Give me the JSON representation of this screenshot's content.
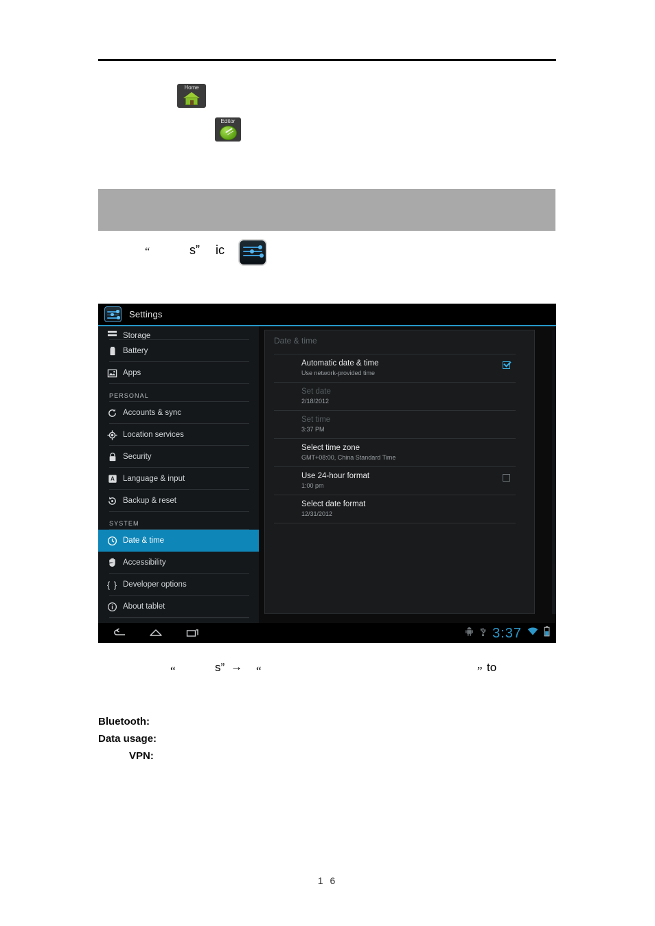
{
  "document": {
    "page_number": "1 6",
    "app_icons": [
      {
        "name": "home-app-icon",
        "caption": "Home"
      },
      {
        "name": "editor-app-icon",
        "caption": "Editor"
      }
    ],
    "inline_line": {
      "quote_open": "“",
      "fragment_s": "s”",
      "trailing": "ic"
    },
    "instruction_line": {
      "quote_open_1": "“",
      "fragment_s": "s”",
      "arrow": "→",
      "quote_open_2": "“",
      "quote_close": "”",
      "trailing": "to"
    },
    "terms": [
      {
        "label": "Bluetooth:",
        "indent": false
      },
      {
        "label": "Data usage:",
        "indent": false
      },
      {
        "label": "VPN:",
        "indent": true
      }
    ]
  },
  "tablet": {
    "title": "Settings",
    "accent_color": "#2597c9",
    "selected_color": "#0f86b8",
    "sidebar": {
      "items": [
        {
          "label": "Storage",
          "icon": "storage-icon",
          "type": "item",
          "clipped": true,
          "selected": false
        },
        {
          "label": "Battery",
          "icon": "battery-icon",
          "type": "item",
          "clipped": false,
          "selected": false
        },
        {
          "label": "Apps",
          "icon": "apps-icon",
          "type": "item",
          "clipped": false,
          "selected": false
        },
        {
          "label": "PERSONAL",
          "icon": "",
          "type": "group",
          "clipped": false,
          "selected": false
        },
        {
          "label": "Accounts & sync",
          "icon": "sync-icon",
          "type": "item",
          "clipped": false,
          "selected": false
        },
        {
          "label": "Location services",
          "icon": "location-icon",
          "type": "item",
          "clipped": false,
          "selected": false
        },
        {
          "label": "Security",
          "icon": "lock-icon",
          "type": "item",
          "clipped": false,
          "selected": false
        },
        {
          "label": "Language & input",
          "icon": "keyboard-a-icon",
          "type": "item",
          "clipped": false,
          "selected": false
        },
        {
          "label": "Backup & reset",
          "icon": "backup-reset-icon",
          "type": "item",
          "clipped": false,
          "selected": false
        },
        {
          "label": "SYSTEM",
          "icon": "",
          "type": "group",
          "clipped": false,
          "selected": false
        },
        {
          "label": "Date & time",
          "icon": "clock-icon",
          "type": "item",
          "clipped": false,
          "selected": true
        },
        {
          "label": "Accessibility",
          "icon": "hand-icon",
          "type": "item",
          "clipped": false,
          "selected": false
        },
        {
          "label": "Developer options",
          "icon": "braces-icon",
          "type": "item",
          "clipped": false,
          "selected": false
        },
        {
          "label": "About tablet",
          "icon": "info-icon",
          "type": "item",
          "clipped": false,
          "selected": false
        }
      ]
    },
    "content": {
      "heading": "Date & time",
      "items": [
        {
          "title": "Automatic date & time",
          "subtitle": "Use network-provided time",
          "checkbox": "checked",
          "disabled": false
        },
        {
          "title": "Set date",
          "subtitle": "2/18/2012",
          "checkbox": "none",
          "disabled": true
        },
        {
          "title": "Set time",
          "subtitle": "3:37 PM",
          "checkbox": "none",
          "disabled": true
        },
        {
          "title": "Select time zone",
          "subtitle": "GMT+08:00, China Standard Time",
          "checkbox": "none",
          "disabled": false
        },
        {
          "title": "Use 24-hour format",
          "subtitle": "1:00 pm",
          "checkbox": "unchecked",
          "disabled": false
        },
        {
          "title": "Select date format",
          "subtitle": "12/31/2012",
          "checkbox": "none",
          "disabled": false
        }
      ]
    },
    "navbar": {
      "back": "back-icon",
      "home": "home-icon",
      "recent": "recent-apps-icon"
    },
    "statusbar": {
      "android_icon": "android-robot-icon",
      "usb_icon": "usb-icon",
      "clock": "3:37",
      "wifi_icon": "wifi-icon",
      "battery_icon": "battery-icon"
    }
  }
}
